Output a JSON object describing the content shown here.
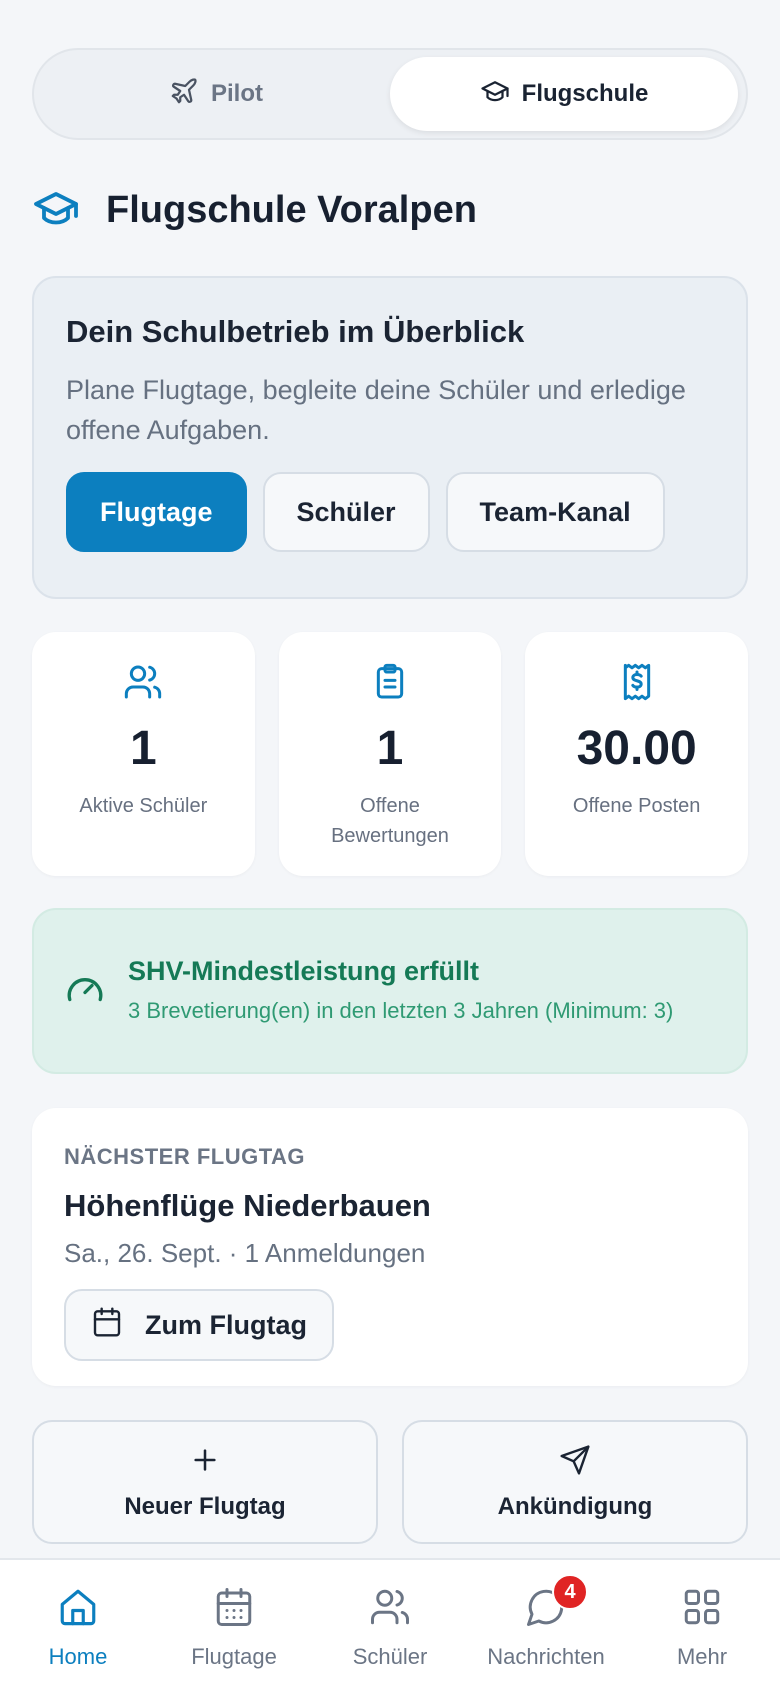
{
  "mode_switch": {
    "pilot_label": "Pilot",
    "school_label": "Flugschule",
    "active": "school"
  },
  "school": {
    "name": "Flugschule Voralpen"
  },
  "overview": {
    "title": "Dein Schulbetrieb im Überblick",
    "description": "Plane Flugtage, begleite deine Schüler und erledige offene Aufgaben.",
    "buttons": [
      {
        "label": "Flugtage",
        "primary": true
      },
      {
        "label": "Schüler",
        "primary": false
      },
      {
        "label": "Team-Kanal",
        "primary": false
      }
    ]
  },
  "stats": [
    {
      "value": "1",
      "label": "Aktive Schüler",
      "icon": "users-icon"
    },
    {
      "value": "1",
      "label": "Offene Bewertungen",
      "icon": "clipboard-icon"
    },
    {
      "value": "30.00",
      "label": "Offene Posten",
      "icon": "receipt-dollar-icon"
    }
  ],
  "shv": {
    "title": "SHV-Mindestleistung erfüllt",
    "detail": "3 Brevetierung(en) in den letzten 3 Jahren (Minimum: 3)",
    "icon": "gauge-icon"
  },
  "next_flight_day": {
    "kicker": "NÄCHSTER FLUGTAG",
    "name": "Höhenflüge Niederbauen",
    "meta": "Sa., 26. Sept. · 1 Anmeldungen",
    "button_label": "Zum Flugtag"
  },
  "quick_actions": [
    {
      "label": "Neuer Flugtag",
      "icon": "plus-icon"
    },
    {
      "label": "Ankündigung",
      "icon": "send-icon"
    }
  ],
  "tabbar": {
    "items": [
      {
        "label": "Home",
        "icon": "home-icon",
        "active": true
      },
      {
        "label": "Flugtage",
        "icon": "calendar-icon"
      },
      {
        "label": "Schüler",
        "icon": "users-icon"
      },
      {
        "label": "Nachrichten",
        "icon": "chat-icon",
        "badge": "4"
      },
      {
        "label": "Mehr",
        "icon": "grid-icon"
      }
    ]
  },
  "colors": {
    "accent": "#0c7fbf",
    "success_bg": "#dff1ec",
    "success_text": "#157a56",
    "badge": "#e02424"
  }
}
